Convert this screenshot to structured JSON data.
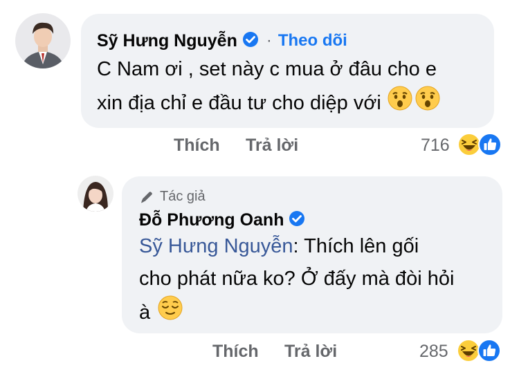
{
  "comment1": {
    "author": "Sỹ Hưng Nguyễn",
    "separator": "·",
    "follow_label": "Theo dõi",
    "line1": "C Nam ơi , set này c mua ở đâu cho e",
    "line2": "xin địa chỉ e đầu tư cho diệp với",
    "emoji": [
      "astonished-face",
      "astonished-face"
    ],
    "actions": {
      "like": "Thích",
      "reply": "Trả lời"
    },
    "reaction_count": "716",
    "reactions": [
      "haha",
      "like"
    ]
  },
  "comment2": {
    "badge": "Tác giả",
    "author": "Đỗ Phương Oanh",
    "mention": "Sỹ Hưng Nguyễn",
    "line1_rest": ": Thích lên gối",
    "line2": "cho phát nữa ko? Ở đấy mà đòi hỏi",
    "line3": "à",
    "emoji": [
      "relieved-face"
    ],
    "actions": {
      "like": "Thích",
      "reply": "Trả lời"
    },
    "reaction_count": "285",
    "reactions": [
      "haha",
      "like"
    ]
  },
  "colors": {
    "bubble": "#f0f2f5",
    "link": "#1877f2",
    "secondary": "#65676b",
    "mention": "#385898"
  }
}
